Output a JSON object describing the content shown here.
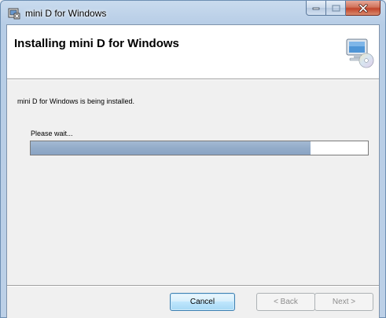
{
  "window": {
    "title": "mini D for Windows",
    "minimize_icon": "minimize-icon",
    "maximize_icon": "maximize-icon",
    "close_icon": "close-icon"
  },
  "banner": {
    "title": "Installing mini D for Windows",
    "icon": "computer-install-icon"
  },
  "body": {
    "status_text": "mini D for Windows is being installed.",
    "wait_text": "Please wait...",
    "progress_fraction": 0.83
  },
  "buttons": {
    "cancel": "Cancel",
    "back": "< Back",
    "next": "Next >"
  },
  "colors": {
    "progress_fill": "#93acc9",
    "focused_button_border": "#3c7fb1",
    "close_button": "#c1442a"
  }
}
